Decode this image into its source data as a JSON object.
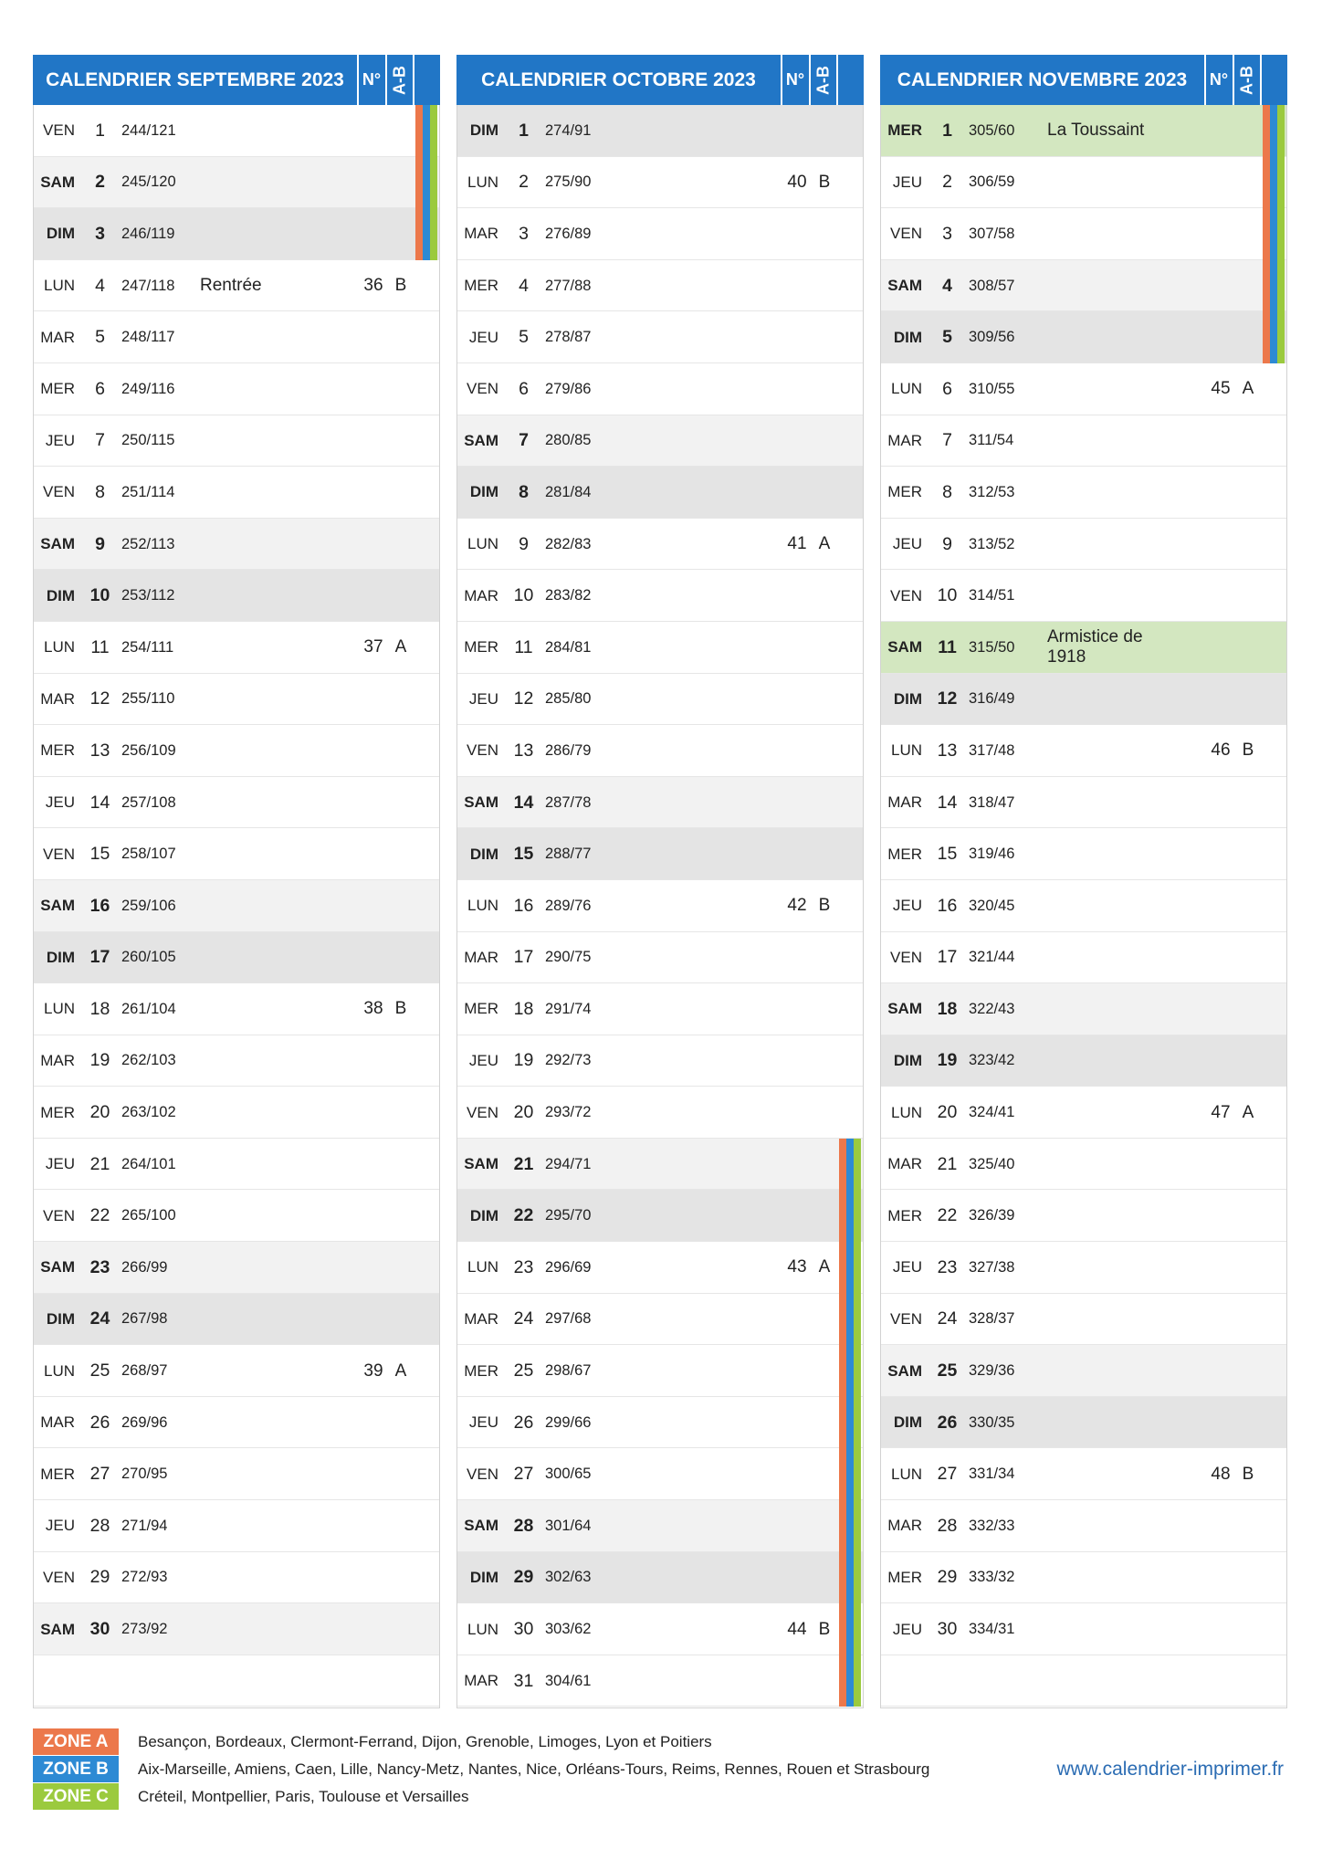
{
  "colors": {
    "header": "#2176c6",
    "saturday_bg": "#f2f2f2",
    "sunday_bg": "#e4e4e4",
    "holiday_bg": "#d3e7c0",
    "text": "#222222",
    "website": "#2b6cb3"
  },
  "headers": {
    "week": "N°",
    "ab": "A-B"
  },
  "months": [
    {
      "title": "CALENDRIER SEPTEMBRE 2023",
      "days": [
        {
          "day": "VEN",
          "num": 1,
          "doy": "244/121",
          "vacation": true
        },
        {
          "day": "SAM",
          "num": 2,
          "doy": "245/120",
          "vacation": true
        },
        {
          "day": "DIM",
          "num": 3,
          "doy": "246/119",
          "vacation": true
        },
        {
          "day": "LUN",
          "num": 4,
          "doy": "247/118",
          "event": "Rentrée",
          "week": 36,
          "ab": "B"
        },
        {
          "day": "MAR",
          "num": 5,
          "doy": "248/117"
        },
        {
          "day": "MER",
          "num": 6,
          "doy": "249/116"
        },
        {
          "day": "JEU",
          "num": 7,
          "doy": "250/115"
        },
        {
          "day": "VEN",
          "num": 8,
          "doy": "251/114"
        },
        {
          "day": "SAM",
          "num": 9,
          "doy": "252/113"
        },
        {
          "day": "DIM",
          "num": 10,
          "doy": "253/112"
        },
        {
          "day": "LUN",
          "num": 11,
          "doy": "254/111",
          "week": 37,
          "ab": "A"
        },
        {
          "day": "MAR",
          "num": 12,
          "doy": "255/110"
        },
        {
          "day": "MER",
          "num": 13,
          "doy": "256/109"
        },
        {
          "day": "JEU",
          "num": 14,
          "doy": "257/108"
        },
        {
          "day": "VEN",
          "num": 15,
          "doy": "258/107"
        },
        {
          "day": "SAM",
          "num": 16,
          "doy": "259/106"
        },
        {
          "day": "DIM",
          "num": 17,
          "doy": "260/105"
        },
        {
          "day": "LUN",
          "num": 18,
          "doy": "261/104",
          "week": 38,
          "ab": "B"
        },
        {
          "day": "MAR",
          "num": 19,
          "doy": "262/103"
        },
        {
          "day": "MER",
          "num": 20,
          "doy": "263/102"
        },
        {
          "day": "JEU",
          "num": 21,
          "doy": "264/101"
        },
        {
          "day": "VEN",
          "num": 22,
          "doy": "265/100"
        },
        {
          "day": "SAM",
          "num": 23,
          "doy": "266/99"
        },
        {
          "day": "DIM",
          "num": 24,
          "doy": "267/98"
        },
        {
          "day": "LUN",
          "num": 25,
          "doy": "268/97",
          "week": 39,
          "ab": "A"
        },
        {
          "day": "MAR",
          "num": 26,
          "doy": "269/96"
        },
        {
          "day": "MER",
          "num": 27,
          "doy": "270/95"
        },
        {
          "day": "JEU",
          "num": 28,
          "doy": "271/94"
        },
        {
          "day": "VEN",
          "num": 29,
          "doy": "272/93"
        },
        {
          "day": "SAM",
          "num": 30,
          "doy": "273/92"
        }
      ]
    },
    {
      "title": "CALENDRIER OCTOBRE 2023",
      "days": [
        {
          "day": "DIM",
          "num": 1,
          "doy": "274/91"
        },
        {
          "day": "LUN",
          "num": 2,
          "doy": "275/90",
          "week": 40,
          "ab": "B"
        },
        {
          "day": "MAR",
          "num": 3,
          "doy": "276/89"
        },
        {
          "day": "MER",
          "num": 4,
          "doy": "277/88"
        },
        {
          "day": "JEU",
          "num": 5,
          "doy": "278/87"
        },
        {
          "day": "VEN",
          "num": 6,
          "doy": "279/86"
        },
        {
          "day": "SAM",
          "num": 7,
          "doy": "280/85"
        },
        {
          "day": "DIM",
          "num": 8,
          "doy": "281/84"
        },
        {
          "day": "LUN",
          "num": 9,
          "doy": "282/83",
          "week": 41,
          "ab": "A"
        },
        {
          "day": "MAR",
          "num": 10,
          "doy": "283/82"
        },
        {
          "day": "MER",
          "num": 11,
          "doy": "284/81"
        },
        {
          "day": "JEU",
          "num": 12,
          "doy": "285/80"
        },
        {
          "day": "VEN",
          "num": 13,
          "doy": "286/79"
        },
        {
          "day": "SAM",
          "num": 14,
          "doy": "287/78"
        },
        {
          "day": "DIM",
          "num": 15,
          "doy": "288/77"
        },
        {
          "day": "LUN",
          "num": 16,
          "doy": "289/76",
          "week": 42,
          "ab": "B"
        },
        {
          "day": "MAR",
          "num": 17,
          "doy": "290/75"
        },
        {
          "day": "MER",
          "num": 18,
          "doy": "291/74"
        },
        {
          "day": "JEU",
          "num": 19,
          "doy": "292/73"
        },
        {
          "day": "VEN",
          "num": 20,
          "doy": "293/72"
        },
        {
          "day": "SAM",
          "num": 21,
          "doy": "294/71",
          "vacation": true
        },
        {
          "day": "DIM",
          "num": 22,
          "doy": "295/70",
          "vacation": true
        },
        {
          "day": "LUN",
          "num": 23,
          "doy": "296/69",
          "week": 43,
          "ab": "A",
          "vacation": true
        },
        {
          "day": "MAR",
          "num": 24,
          "doy": "297/68",
          "vacation": true
        },
        {
          "day": "MER",
          "num": 25,
          "doy": "298/67",
          "vacation": true
        },
        {
          "day": "JEU",
          "num": 26,
          "doy": "299/66",
          "vacation": true
        },
        {
          "day": "VEN",
          "num": 27,
          "doy": "300/65",
          "vacation": true
        },
        {
          "day": "SAM",
          "num": 28,
          "doy": "301/64",
          "vacation": true
        },
        {
          "day": "DIM",
          "num": 29,
          "doy": "302/63",
          "vacation": true
        },
        {
          "day": "LUN",
          "num": 30,
          "doy": "303/62",
          "week": 44,
          "ab": "B",
          "vacation": true
        },
        {
          "day": "MAR",
          "num": 31,
          "doy": "304/61",
          "vacation": true
        }
      ]
    },
    {
      "title": "CALENDRIER NOVEMBRE 2023",
      "days": [
        {
          "day": "MER",
          "num": 1,
          "doy": "305/60",
          "event": "La Toussaint",
          "holiday": true,
          "vacation": true
        },
        {
          "day": "JEU",
          "num": 2,
          "doy": "306/59",
          "vacation": true
        },
        {
          "day": "VEN",
          "num": 3,
          "doy": "307/58",
          "vacation": true
        },
        {
          "day": "SAM",
          "num": 4,
          "doy": "308/57",
          "vacation": true
        },
        {
          "day": "DIM",
          "num": 5,
          "doy": "309/56",
          "vacation": true
        },
        {
          "day": "LUN",
          "num": 6,
          "doy": "310/55",
          "week": 45,
          "ab": "A"
        },
        {
          "day": "MAR",
          "num": 7,
          "doy": "311/54"
        },
        {
          "day": "MER",
          "num": 8,
          "doy": "312/53"
        },
        {
          "day": "JEU",
          "num": 9,
          "doy": "313/52"
        },
        {
          "day": "VEN",
          "num": 10,
          "doy": "314/51"
        },
        {
          "day": "SAM",
          "num": 11,
          "doy": "315/50",
          "event": "Armistice de 1918",
          "holiday": true
        },
        {
          "day": "DIM",
          "num": 12,
          "doy": "316/49"
        },
        {
          "day": "LUN",
          "num": 13,
          "doy": "317/48",
          "week": 46,
          "ab": "B"
        },
        {
          "day": "MAR",
          "num": 14,
          "doy": "318/47"
        },
        {
          "day": "MER",
          "num": 15,
          "doy": "319/46"
        },
        {
          "day": "JEU",
          "num": 16,
          "doy": "320/45"
        },
        {
          "day": "VEN",
          "num": 17,
          "doy": "321/44"
        },
        {
          "day": "SAM",
          "num": 18,
          "doy": "322/43"
        },
        {
          "day": "DIM",
          "num": 19,
          "doy": "323/42"
        },
        {
          "day": "LUN",
          "num": 20,
          "doy": "324/41",
          "week": 47,
          "ab": "A"
        },
        {
          "day": "MAR",
          "num": 21,
          "doy": "325/40"
        },
        {
          "day": "MER",
          "num": 22,
          "doy": "326/39"
        },
        {
          "day": "JEU",
          "num": 23,
          "doy": "327/38"
        },
        {
          "day": "VEN",
          "num": 24,
          "doy": "328/37"
        },
        {
          "day": "SAM",
          "num": 25,
          "doy": "329/36"
        },
        {
          "day": "DIM",
          "num": 26,
          "doy": "330/35"
        },
        {
          "day": "LUN",
          "num": 27,
          "doy": "331/34",
          "week": 48,
          "ab": "B"
        },
        {
          "day": "MAR",
          "num": 28,
          "doy": "332/33"
        },
        {
          "day": "MER",
          "num": 29,
          "doy": "333/32"
        },
        {
          "day": "JEU",
          "num": 30,
          "doy": "334/31"
        }
      ]
    }
  ],
  "zones": [
    {
      "label": "ZONE A",
      "color": "#ec784b",
      "cities": "Besançon, Bordeaux, Clermont-Ferrand, Dijon, Grenoble, Limoges, Lyon et Poitiers"
    },
    {
      "label": "ZONE B",
      "color": "#2d8ad4",
      "cities": "Aix-Marseille, Amiens, Caen, Lille, Nancy-Metz, Nantes, Nice, Orléans-Tours, Reims, Rennes, Rouen et Strasbourg"
    },
    {
      "label": "ZONE C",
      "color": "#9bca3e",
      "cities": "Créteil, Montpellier, Paris, Toulouse et Versailles"
    }
  ],
  "footer": {
    "website": "www.calendrier-imprimer.fr"
  }
}
